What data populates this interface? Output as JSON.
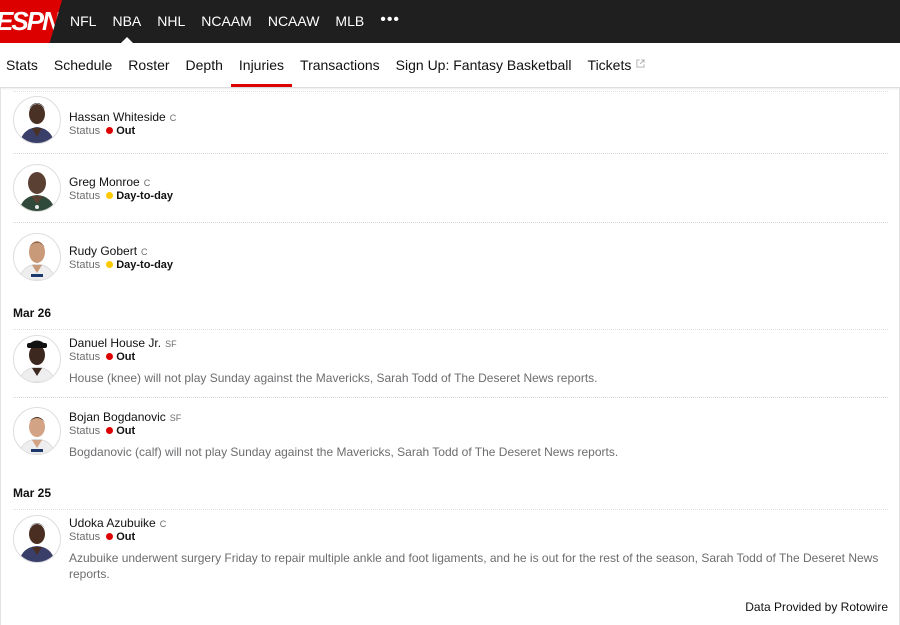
{
  "logo": {
    "text": "ESPN"
  },
  "top_nav": {
    "items": [
      "NFL",
      "NBA",
      "NHL",
      "NCAAM",
      "NCAAW",
      "MLB"
    ],
    "active": "NBA",
    "more_label": "•••"
  },
  "sub_nav": {
    "items": [
      "Stats",
      "Schedule",
      "Roster",
      "Depth",
      "Injuries",
      "Transactions",
      "Sign Up: Fantasy Basketball",
      "Tickets"
    ],
    "active": "Injuries"
  },
  "status_label": "Status",
  "colors": {
    "out": "#d00",
    "day_to_day": "#fcc900",
    "accent": "#d00",
    "nav_bg": "#1f1f20"
  },
  "groups": [
    {
      "date": "",
      "players": [
        {
          "name": "Hassan Whiteside",
          "position": "C",
          "status": "Out",
          "status_color": "#d00",
          "description": ""
        },
        {
          "name": "Greg Monroe",
          "position": "C",
          "status": "Day-to-day",
          "status_color": "#fcc900",
          "description": ""
        },
        {
          "name": "Rudy Gobert",
          "position": "C",
          "status": "Day-to-day",
          "status_color": "#fcc900",
          "description": ""
        }
      ]
    },
    {
      "date": "Mar 26",
      "players": [
        {
          "name": "Danuel House Jr.",
          "position": "SF",
          "status": "Out",
          "status_color": "#d00",
          "description": "House (knee) will not play Sunday against the Mavericks, Sarah Todd of The Deseret News reports."
        },
        {
          "name": "Bojan Bogdanovic",
          "position": "SF",
          "status": "Out",
          "status_color": "#d00",
          "description": "Bogdanovic (calf) will not play Sunday against the Mavericks, Sarah Todd of The Deseret News reports."
        }
      ]
    },
    {
      "date": "Mar 25",
      "players": [
        {
          "name": "Udoka Azubuike",
          "position": "C",
          "status": "Out",
          "status_color": "#d00",
          "description": "Azubuike underwent surgery Friday to repair multiple ankle and foot ligaments, and he is out for the rest of the season, Sarah Todd of The Deseret News reports."
        }
      ]
    }
  ],
  "footer": {
    "text": "Data Provided by Rotowire"
  }
}
